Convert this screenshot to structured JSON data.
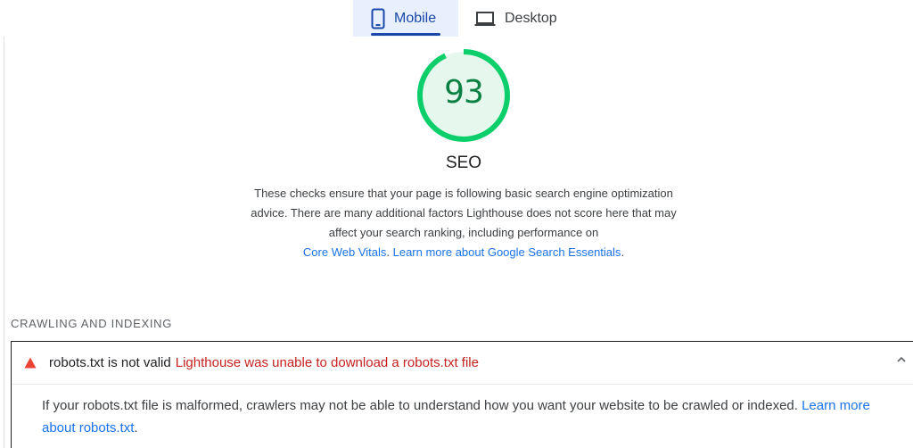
{
  "tabs": [
    {
      "label": "Mobile",
      "icon": "smartphone-icon",
      "selected": true
    },
    {
      "label": "Desktop",
      "icon": "laptop-icon",
      "selected": false
    }
  ],
  "category": {
    "score": "93",
    "score_fraction": 0.93,
    "title": "SEO",
    "colors": {
      "pass": "#0cce6b",
      "score_text": "#0b8043",
      "fill": "#e6f8ee"
    },
    "description": "These checks ensure that your page is following basic search engine optimization advice. There are many additional factors Lighthouse does not score here that may affect your search ranking, including performance on",
    "link_vitals": "Core Web Vitals",
    "link_essentials": "Learn more about Google Search Essentials"
  },
  "group": {
    "title": "CRAWLING AND INDEXING"
  },
  "audit": {
    "icon": "warning-triangle-icon",
    "title": "robots.txt is not valid",
    "display_value": "Lighthouse was unable to download a robots.txt file",
    "description": "If your robots.txt file is malformed, crawlers may not be able to understand how you want your website to be crawled or indexed.",
    "learn_more": "Learn more about robots.txt",
    "expanded": true,
    "colors": {
      "fail": "#ea4335",
      "display_value": "#c5221f",
      "link": "#1a73e8"
    }
  }
}
